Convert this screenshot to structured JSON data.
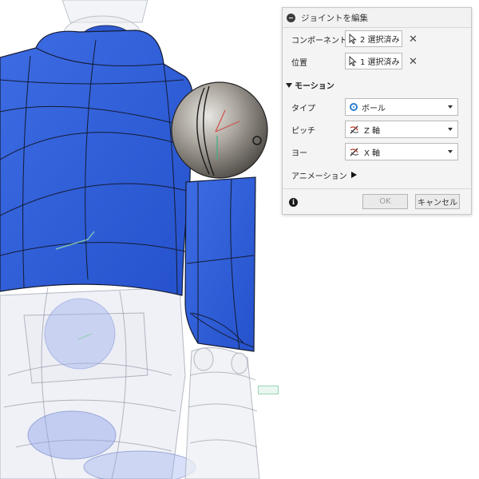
{
  "dialog": {
    "title": "ジョイントを編集",
    "component_label": "コンポーネント",
    "component_value": "2 選択済み",
    "position_label": "位置",
    "position_value": "1 選択済み",
    "motion_section": "モーション",
    "type_label": "タイプ",
    "type_value": "ボール",
    "pitch_label": "ピッチ",
    "pitch_value": "Z 軸",
    "yaw_label": "ヨー",
    "yaw_value": "X 軸",
    "animation_label": "アニメーション",
    "ok_label": "OK",
    "cancel_label": "キャンセル"
  },
  "icons": [
    "collapse-icon",
    "cursor-select-icon",
    "clear-icon",
    "ball-joint-icon",
    "axis-icon",
    "play-icon",
    "info-icon"
  ],
  "colors": {
    "body_blue": "#2f5fd9",
    "accent_blue": "#2a7fd4",
    "metal_ball": "#8f8a82"
  }
}
